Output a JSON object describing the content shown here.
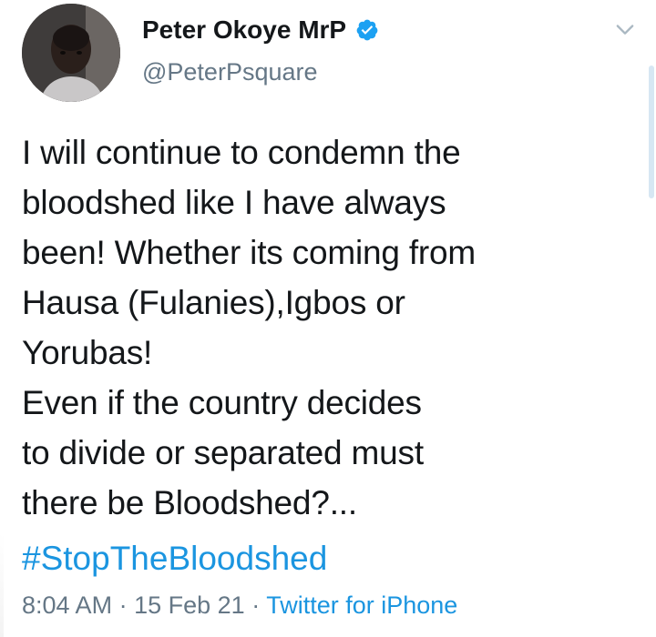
{
  "user": {
    "name": "Peter Okoye MrP",
    "handle": "@PeterPsquare",
    "verified": true,
    "avatar_icon": "profile-photo-icon"
  },
  "tweet": {
    "text": "I will continue to condemn the\nbloodshed like I have always\nbeen! Whether its coming from\nHausa (Fulanies),Igbos or\nYorubas!\nEven if the country decides\nto divide or separated must\nthere be Bloodshed?...",
    "hashtag": "#StopTheBloodshed"
  },
  "meta": {
    "time": "8:04 AM",
    "date": "15 Feb 21",
    "source": "Twitter for iPhone",
    "separator": "·"
  },
  "colors": {
    "link": "#1b95e0",
    "secondary": "#657786",
    "verified": "#1da1f2"
  }
}
